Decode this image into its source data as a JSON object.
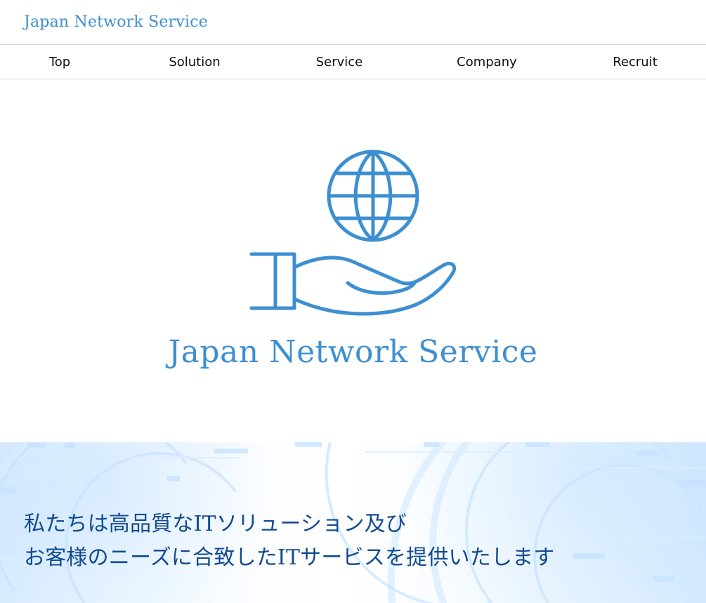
{
  "header": {
    "brand": "Japan Network Service"
  },
  "nav": {
    "items": [
      {
        "label": "Top"
      },
      {
        "label": "Solution"
      },
      {
        "label": "Service"
      },
      {
        "label": "Company"
      },
      {
        "label": "Recruit"
      }
    ]
  },
  "hero": {
    "logo_icon": "globe-in-hand-icon",
    "title": "Japan Network Service",
    "accent_color": "#3d8fd1"
  },
  "message": {
    "line1": "私たちは高品質なITソリューション及び",
    "line2": "お客様のニーズに合致したITサービスを提供いたします",
    "text_color": "#124b8f"
  }
}
